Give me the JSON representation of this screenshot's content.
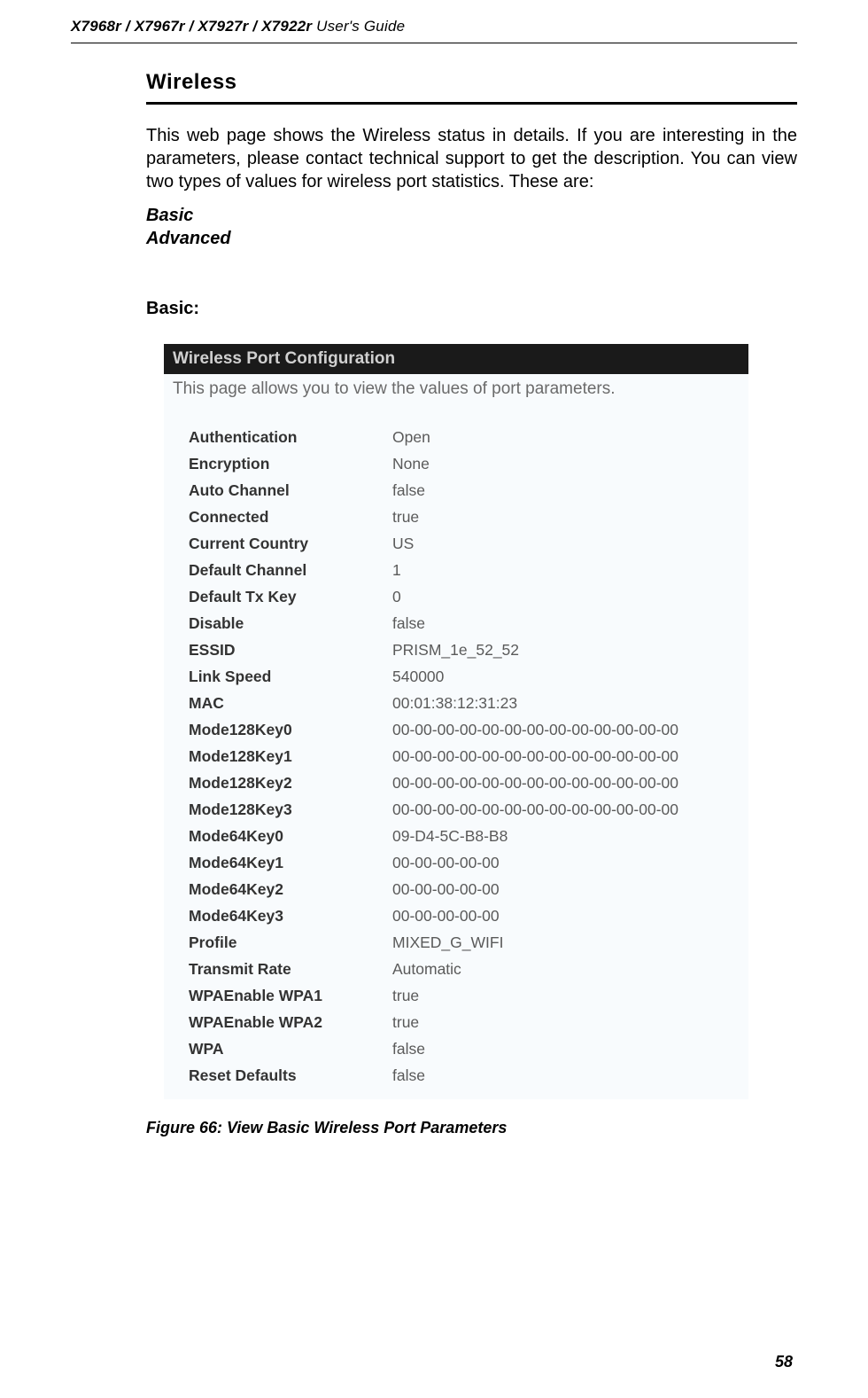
{
  "header": {
    "models": "X7968r / X7967r / X7927r / X7922r",
    "guide": " User's Guide"
  },
  "section": {
    "title": "Wireless",
    "intro": "This web page shows the Wireless status in details. If you are interesting in the parameters, please contact technical support to get the description. You can view two types of values for wireless port statistics. These are:",
    "link1": "Basic",
    "link2": "Advanced",
    "subheading": "Basic:"
  },
  "panel": {
    "title": "Wireless Port Configuration",
    "desc": "This page allows you to view the values of port parameters."
  },
  "params": [
    {
      "label": "Authentication",
      "value": "Open"
    },
    {
      "label": "Encryption",
      "value": "None"
    },
    {
      "label": "Auto Channel",
      "value": "false"
    },
    {
      "label": "Connected",
      "value": "true"
    },
    {
      "label": "Current Country",
      "value": "US"
    },
    {
      "label": "Default Channel",
      "value": "1"
    },
    {
      "label": "Default Tx Key",
      "value": "0"
    },
    {
      "label": "Disable",
      "value": "false"
    },
    {
      "label": "ESSID",
      "value": "PRISM_1e_52_52"
    },
    {
      "label": "Link Speed",
      "value": "540000"
    },
    {
      "label": "MAC",
      "value": "00:01:38:12:31:23"
    },
    {
      "label": "Mode128Key0",
      "value": "00-00-00-00-00-00-00-00-00-00-00-00-00"
    },
    {
      "label": "Mode128Key1",
      "value": "00-00-00-00-00-00-00-00-00-00-00-00-00"
    },
    {
      "label": "Mode128Key2",
      "value": "00-00-00-00-00-00-00-00-00-00-00-00-00"
    },
    {
      "label": "Mode128Key3",
      "value": "00-00-00-00-00-00-00-00-00-00-00-00-00"
    },
    {
      "label": "Mode64Key0",
      "value": "09-D4-5C-B8-B8"
    },
    {
      "label": "Mode64Key1",
      "value": "00-00-00-00-00"
    },
    {
      "label": "Mode64Key2",
      "value": "00-00-00-00-00"
    },
    {
      "label": "Mode64Key3",
      "value": "00-00-00-00-00"
    },
    {
      "label": "Profile",
      "value": "MIXED_G_WIFI"
    },
    {
      "label": "Transmit Rate",
      "value": "Automatic"
    },
    {
      "label": "WPAEnable WPA1",
      "value": "true"
    },
    {
      "label": "WPAEnable WPA2",
      "value": "true"
    },
    {
      "label": "WPA",
      "value": "false"
    },
    {
      "label": "Reset Defaults",
      "value": "false"
    }
  ],
  "figure_caption": "Figure 66: View Basic Wireless Port Parameters",
  "page_number": "58"
}
